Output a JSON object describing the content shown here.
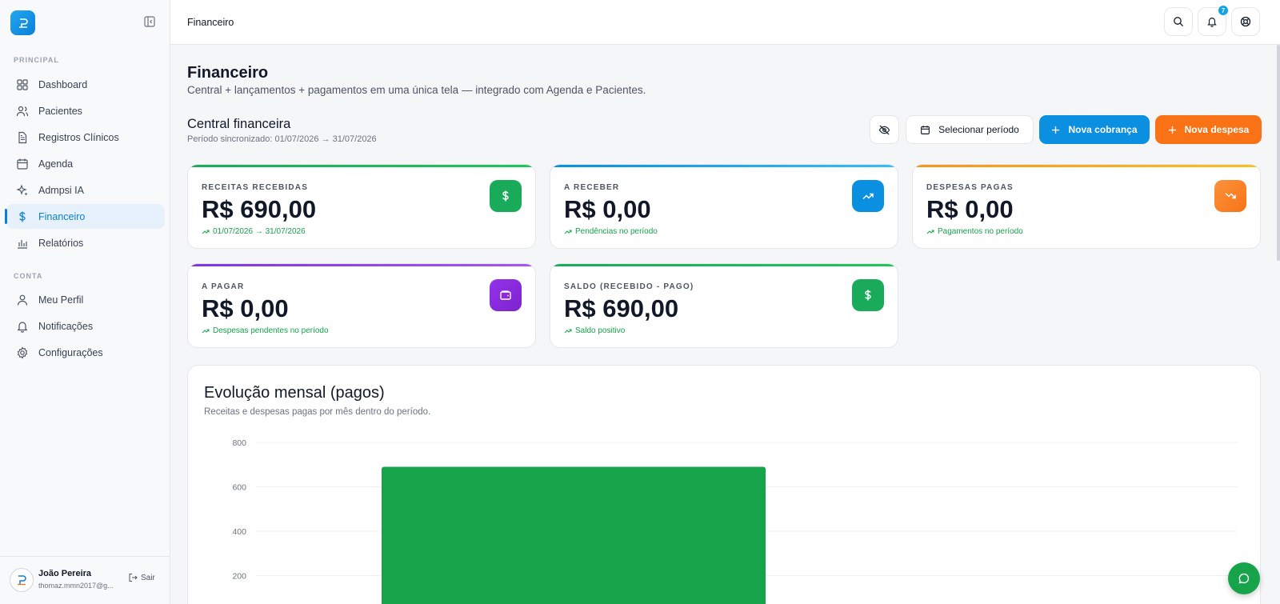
{
  "sidebar": {
    "section_main": "PRINCIPAL",
    "section_account": "CONTA",
    "items": [
      {
        "label": "Dashboard"
      },
      {
        "label": "Pacientes"
      },
      {
        "label": "Registros Clínicos"
      },
      {
        "label": "Agenda"
      },
      {
        "label": "Admpsi IA"
      },
      {
        "label": "Financeiro",
        "active": true
      },
      {
        "label": "Relatórios"
      }
    ],
    "account_items": [
      {
        "label": "Meu Perfil"
      },
      {
        "label": "Notificações"
      },
      {
        "label": "Configurações"
      }
    ],
    "user": {
      "name": "João Pereira",
      "email": "thomaz.mmn2017@g...",
      "logout": "Sair"
    }
  },
  "topbar": {
    "title": "Financeiro",
    "notifications_count": "7"
  },
  "page": {
    "title": "Financeiro",
    "subtitle": "Central + lançamentos + pagamentos em uma única tela — integrado com Agenda e Pacientes.",
    "section_title": "Central financeira",
    "section_sub": "Período sincronizado: 01/07/2026 → 31/07/2026"
  },
  "actions": {
    "period": "Selecionar período",
    "new_charge": "Nova cobrança",
    "new_expense": "Nova despesa"
  },
  "cards": [
    {
      "label": "RECEITAS RECEBIDAS",
      "value": "R$ 690,00",
      "note": "01/07/2026 → 31/07/2026",
      "color": "#1aab5a",
      "icon": "dollar-icon"
    },
    {
      "label": "A RECEBER",
      "value": "R$ 0,00",
      "note": "Pendências no período",
      "color": "#0b8fe0",
      "icon": "trending-up-icon"
    },
    {
      "label": "DESPESAS PAGAS",
      "value": "R$ 0,00",
      "note": "Pagamentos no período",
      "color": "#f7931e",
      "icon": "trending-down-icon"
    },
    {
      "label": "A PAGAR",
      "value": "R$ 0,00",
      "note": "Despesas pendentes no período",
      "color": "#7e35e0",
      "icon": "wallet-icon"
    },
    {
      "label": "SALDO (RECEBIDO - PAGO)",
      "value": "R$ 690,00",
      "note": "Saldo positivo",
      "color": "#1aab5a",
      "icon": "dollar-icon"
    }
  ],
  "chart": {
    "title": "Evolução mensal (pagos)",
    "subtitle": "Receitas e despesas pagas por mês dentro do período."
  },
  "chart_data": {
    "type": "bar",
    "categories": [
      ""
    ],
    "series": [
      {
        "values": [
          690
        ],
        "color": "#16a34a"
      }
    ],
    "ylim": [
      0,
      800
    ],
    "yticks": [
      200,
      400,
      600,
      800
    ],
    "grid": true
  }
}
